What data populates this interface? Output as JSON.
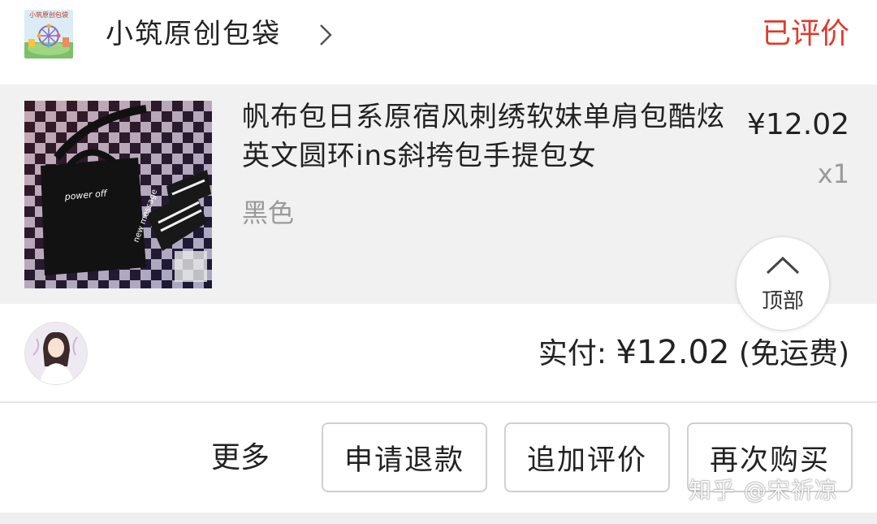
{
  "shop": {
    "logo_text": "小筑原创包袋",
    "name": "小筑原创包袋",
    "status": "已评价"
  },
  "product": {
    "title": "帆布包日系原宿风刺绣软妹单肩包酷炫英文圆环ins斜挎包手提包女",
    "variant": "黑色",
    "price": "¥12.02",
    "quantity": "x1",
    "image_text_1": "power off",
    "image_text_2": "new message"
  },
  "top_button": {
    "label": "顶部"
  },
  "payment": {
    "label": "实付: ",
    "amount": "¥12.02",
    "note": " (免运费)"
  },
  "actions": {
    "more": "更多",
    "refund": "申请退款",
    "add_review": "追加评价",
    "buy_again": "再次购买"
  },
  "watermark": "知乎 @宋祈凉",
  "colors": {
    "accent": "#e0392d",
    "product_bg": "#f1f1f1",
    "border": "#d0d0d0"
  },
  "icons": [
    "chevron-right-icon",
    "chevron-up-icon"
  ]
}
